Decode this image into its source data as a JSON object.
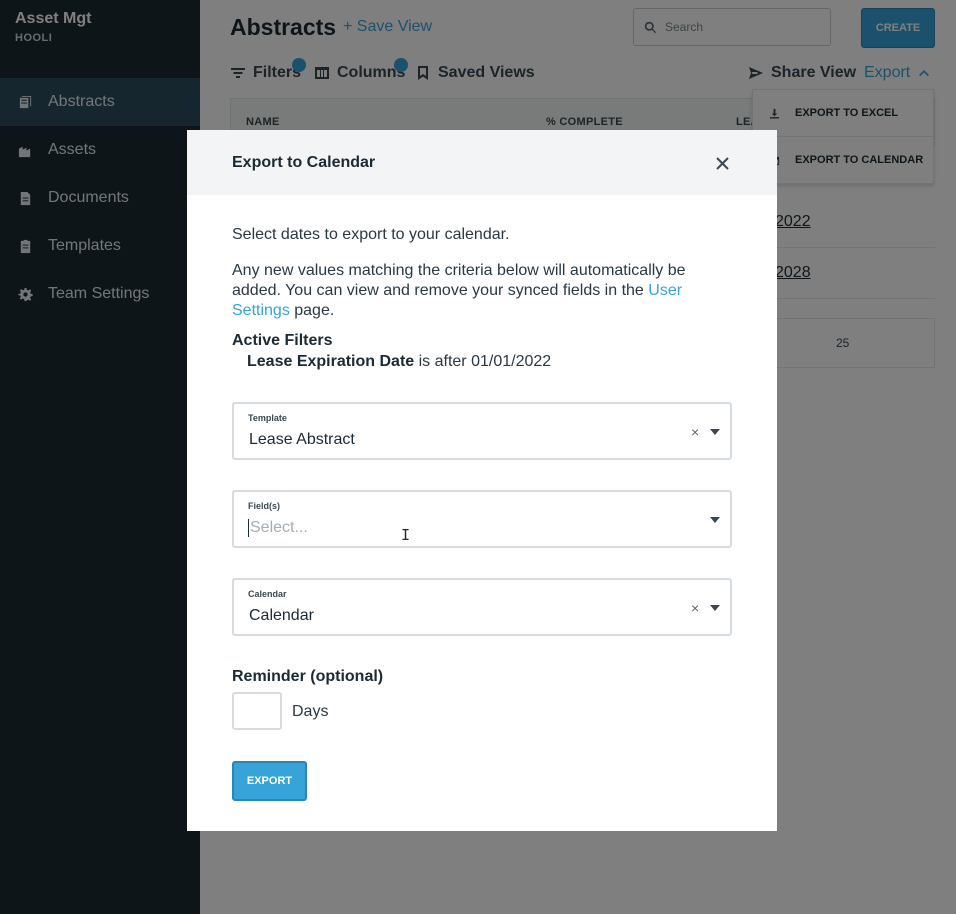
{
  "sidebar": {
    "app_name": "Asset Mgt",
    "org_name": "HOOLI",
    "items": [
      {
        "label": "Abstracts",
        "icon": "abstracts-icon",
        "active": true
      },
      {
        "label": "Assets",
        "icon": "assets-icon"
      },
      {
        "label": "Documents",
        "icon": "document-icon"
      },
      {
        "label": "Templates",
        "icon": "template-icon"
      },
      {
        "label": "Team Settings",
        "icon": "gear-icon"
      }
    ]
  },
  "header": {
    "title": "Abstracts",
    "save_view": "+ Save View",
    "search_placeholder": "Search",
    "create_label": "CREATE"
  },
  "toolbar": {
    "filters": "Filters",
    "columns": "Columns",
    "saved_views": "Saved Views",
    "share_view": "Share View",
    "export": "Export"
  },
  "table": {
    "columns": [
      "NAME",
      "% COMPLETE",
      "LEA"
    ],
    "visible_dates": [
      "2022",
      "2028"
    ],
    "page_size": "25"
  },
  "export_menu": {
    "items": [
      "EXPORT TO EXCEL",
      "EXPORT TO CALENDAR"
    ]
  },
  "modal": {
    "title": "Export to Calendar",
    "intro": "Select dates to export to your calendar.",
    "desc_part1": "Any new values matching the criteria below will automatically be added. You can view and remove your synced fields in the ",
    "desc_link": "User Settings",
    "desc_part2": " page.",
    "active_filters_title": "Active Filters",
    "filter_field": "Lease Expiration Date",
    "filter_rest": " is after 01/01/2022",
    "template_label": "Template",
    "template_value": "Lease Abstract",
    "fields_label": "Field(s)",
    "fields_placeholder": "Select...",
    "calendar_label": "Calendar",
    "calendar_value": "Calendar",
    "reminder_label": "Reminder (optional)",
    "days_label": "Days",
    "export_button": "EXPORT",
    "clear_symbol": "×"
  },
  "colors": {
    "accent": "#36a3d9",
    "sidebar_bg": "#1c2a33",
    "sidebar_active": "#2d4c5f"
  }
}
